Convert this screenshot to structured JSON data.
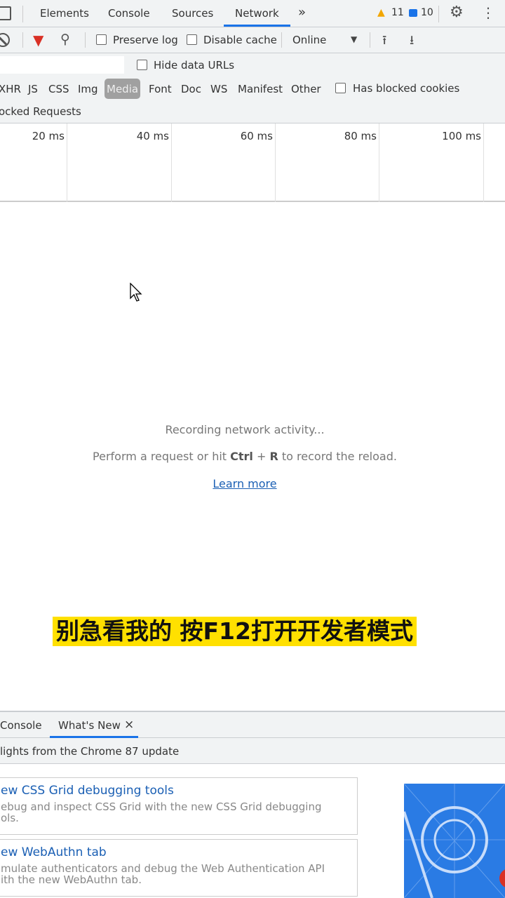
{
  "tabs": {
    "items": [
      "Elements",
      "Console",
      "Sources",
      "Network"
    ],
    "active": "Network",
    "more": "»",
    "warnings": "11",
    "messages": "10"
  },
  "toolbar": {
    "preserve_log": "Preserve log",
    "disable_cache": "Disable cache",
    "throttle": "Online"
  },
  "filter": {
    "hide_data_urls": "Hide data URLs",
    "types": [
      "XHR",
      "JS",
      "CSS",
      "Img",
      "Media",
      "Font",
      "Doc",
      "WS",
      "Manifest",
      "Other"
    ],
    "active_type": "Media",
    "has_blocked_cookies": "Has blocked cookies",
    "blocked_requests": "ocked Requests"
  },
  "timeline": {
    "ticks": [
      "20 ms",
      "40 ms",
      "60 ms",
      "80 ms",
      "100 ms"
    ]
  },
  "empty": {
    "recording": "Recording network activity...",
    "hint_pre": "Perform a request or hit ",
    "hint_ctrl": "Ctrl",
    "hint_plus": " + ",
    "hint_r": "R",
    "hint_post": " to record the reload.",
    "learn_more": "Learn more"
  },
  "subtitle": "别急看我的 按F12打开开发者模式",
  "drawer": {
    "tabs": [
      "Console",
      "What's New"
    ],
    "active": "What's New",
    "close": "×",
    "header": "lights from the Chrome 87 update",
    "cards": [
      {
        "title": "ew CSS Grid debugging tools",
        "desc": "ebug and inspect CSS Grid with the new CSS Grid debugging\nols."
      },
      {
        "title": "ew WebAuthn tab",
        "desc": "mulate authenticators and debug the Web Authentication API\nith the new WebAuthn tab."
      }
    ]
  },
  "colors": {
    "accent": "#1a73e8",
    "link": "#1a5fb4",
    "filter_red": "#d93025",
    "warning": "#f2a600",
    "subtitle_bg": "#ffe000"
  }
}
